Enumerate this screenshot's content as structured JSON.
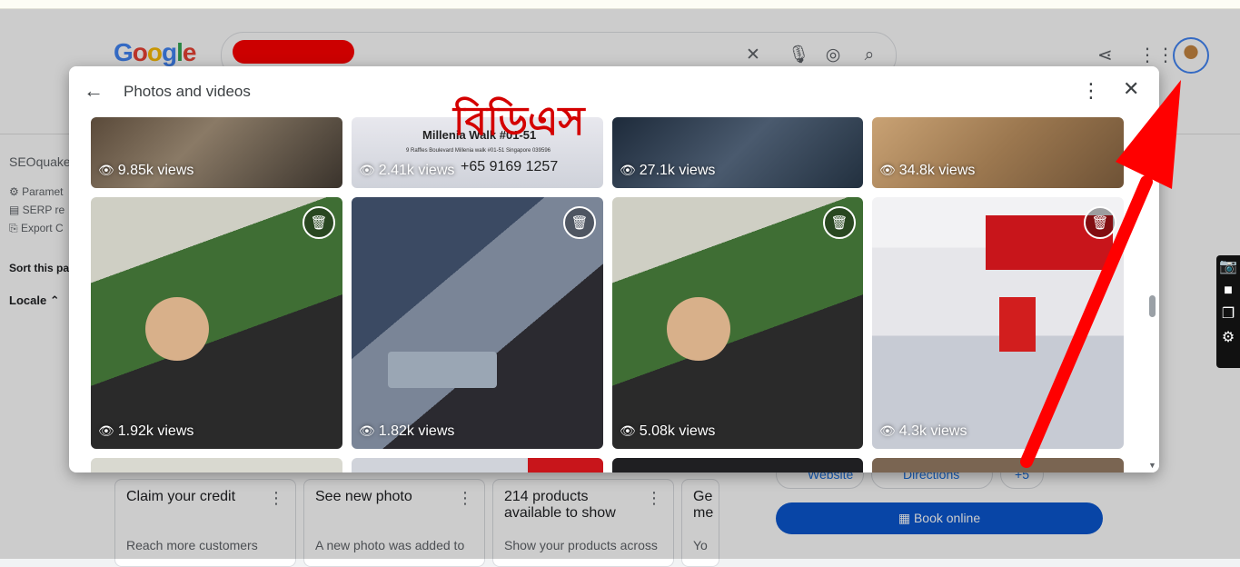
{
  "browser": {
    "top_strip": ""
  },
  "google": {
    "logo": "Google",
    "search": {
      "clear_icon": "close-icon",
      "mic_icon": "mic-icon",
      "lens_icon": "lens-icon",
      "search_icon": "search-icon"
    },
    "header_icons": [
      "share-icon",
      "apps-icon",
      "avatar"
    ]
  },
  "seoquake": {
    "title": "SEOquake",
    "items": [
      "Paramet",
      "SERP re",
      "Export C"
    ],
    "sort": "Sort this pa",
    "locale": "Locale"
  },
  "dialog": {
    "title": "Photos and videos",
    "top_row": [
      {
        "views": "9.85k views"
      },
      {
        "views": "2.41k views",
        "sign_text": "Millenia Walk #01-51",
        "phone": "+65 9169 1257",
        "address": "9 Raffles Boulevard Millenia walk #01-51 Singapore 039596"
      },
      {
        "views": "27.1k views"
      },
      {
        "views": "34.8k views"
      }
    ],
    "main_row": [
      {
        "views": "1.92k views"
      },
      {
        "views": "1.82k views"
      },
      {
        "views": "5.08k views"
      },
      {
        "views": "4.3k views"
      }
    ]
  },
  "overlay": {
    "bengali_text": "বিডিএস"
  },
  "cards": [
    {
      "title": "Claim your credit",
      "desc": "Reach more customers"
    },
    {
      "title": "See new photo",
      "desc": "A new photo was added to"
    },
    {
      "title": "214 products available to show",
      "desc": "Show your products across"
    },
    {
      "title": "Ge me",
      "desc": "Yo"
    }
  ],
  "actions": {
    "website": "Website",
    "directions": "Directions",
    "more": "+5",
    "book": "Book online"
  },
  "colors": {
    "accent": "#0b57d0",
    "arrow": "#ff0000"
  }
}
